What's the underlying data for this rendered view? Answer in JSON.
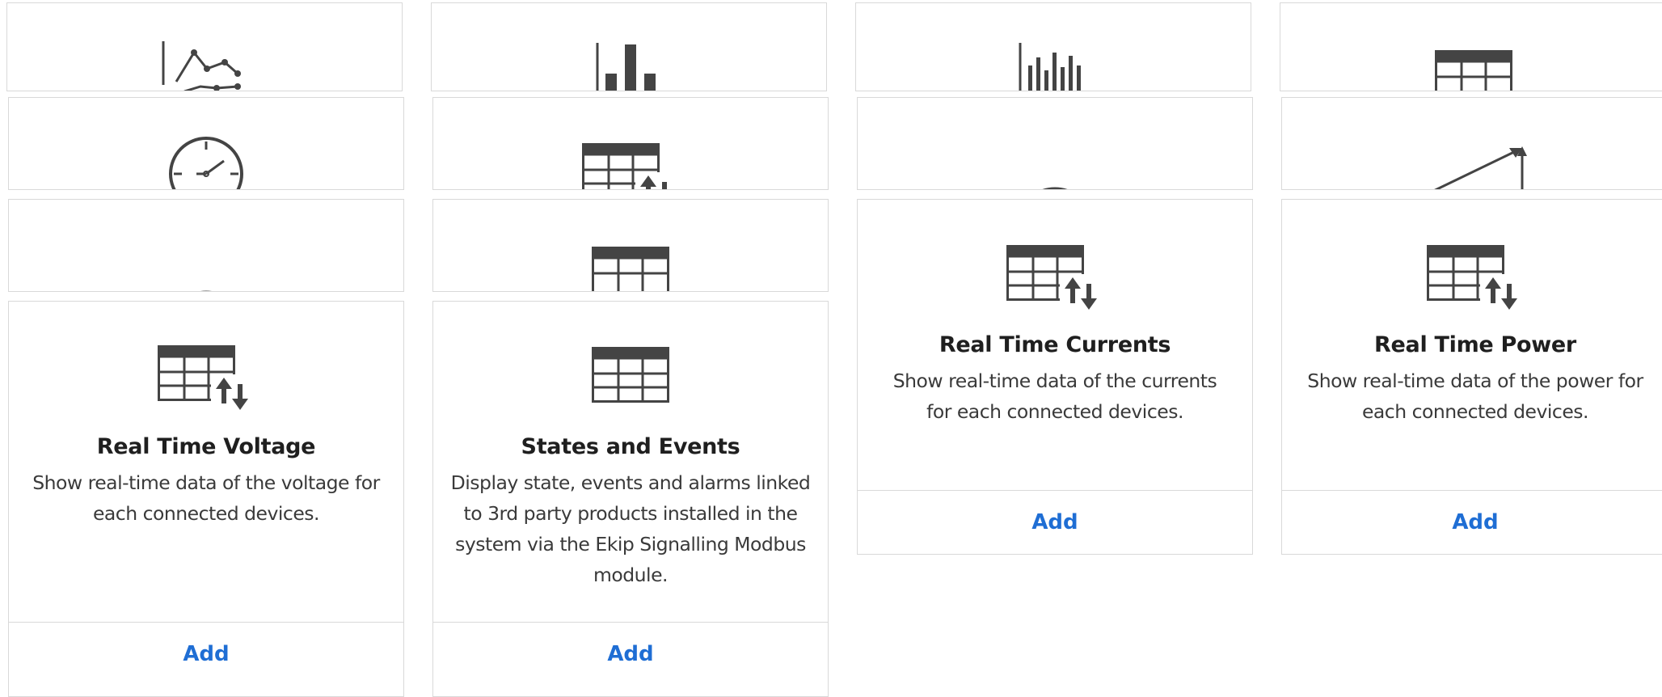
{
  "colors": {
    "icon": "#444444",
    "border": "#d9d9d9",
    "link": "#1f6ed4",
    "title": "#1f1f1f",
    "text": "#3a3a3a"
  },
  "stacked_icons": {
    "row1": [
      "line-chart-icon",
      "bar-chart-icon",
      "histogram-icon",
      "table-icon"
    ],
    "row2": [
      "clock-icon",
      "table-sort-icon",
      "gauge-icon",
      "trend-arrow-icon"
    ],
    "row3": [
      "gauge-icon",
      "table-icon"
    ]
  },
  "cards": [
    {
      "icon": "table-sort-icon",
      "title": "Real Time Voltage",
      "description": "Show real-time data of the voltage for each connected devices.",
      "action": "Add"
    },
    {
      "icon": "table-icon",
      "title": "States and Events",
      "description": "Display state, events and alarms linked to 3rd party products installed in the system via the Ekip Signalling Modbus module.",
      "action": "Add"
    },
    {
      "icon": "table-sort-icon",
      "title": "Real Time Currents",
      "description": "Show real-time data of the currents for each connected devices.",
      "action": "Add"
    },
    {
      "icon": "table-sort-icon",
      "title": "Real Time Power",
      "description": "Show real-time data of the power for each connected devices.",
      "action": "Add"
    }
  ]
}
